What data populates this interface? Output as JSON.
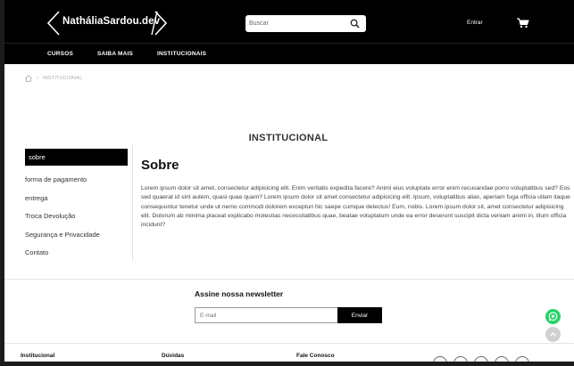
{
  "header": {
    "logo_text": "NatháliaSardou.dev",
    "search": {
      "placeholder": "Buscar"
    },
    "login_label": "Entrar"
  },
  "nav": {
    "items": [
      {
        "label": "CURSOS"
      },
      {
        "label": "SAIBA MAIS"
      },
      {
        "label": "INSTITUCIONAIS"
      }
    ]
  },
  "breadcrumb": {
    "current": "INSTITUCIONAL"
  },
  "page": {
    "heading": "INSTITUCIONAL"
  },
  "sidebar": {
    "items": [
      {
        "label": "sobre",
        "active": true
      },
      {
        "label": "forma de pagamento"
      },
      {
        "label": "entrega"
      },
      {
        "label": "Troca Devolução"
      },
      {
        "label": "Segurança e Privacidade"
      },
      {
        "label": "Contato"
      }
    ]
  },
  "content": {
    "title": "Sobre",
    "body": "Lorem ipsum dolor sit amet, consectetur adipisicing elit. Enim veritatis expedita facere? Animi eius voluptate error enim recusandae porro voluptatibus sed? Eos sed quaerat id sint autem, quasi quae quam? Lorem ipsum dolor sit amet consectetur adipisicing elit. Ipsum, voluptatibus alias, aperiam fuga officia ullam itaque consequuntur tenetur unde ut nemo commodi dolorem excepturi hic saepe cumque delectus! Eum, nobis. Lorem ipsum dolor sit, amet consectetur adipisicing elit. Dolorum ab minima placeat explicabo molestias necessitatibus quae, beatae voluptatum unde ea error deserunt suscipit dicta veniam animi in, illum officia incidunt?"
  },
  "newsletter": {
    "title": "Assine nossa newsletter",
    "email_placeholder": "E-mail",
    "button_label": "Enviar"
  },
  "footer": {
    "columns": [
      {
        "title": "Institucional"
      },
      {
        "title": "Dúvidas"
      },
      {
        "title": "Fale Conosco"
      }
    ]
  },
  "colors": {
    "header_bg": "#000000",
    "whatsapp": "#25d366"
  }
}
